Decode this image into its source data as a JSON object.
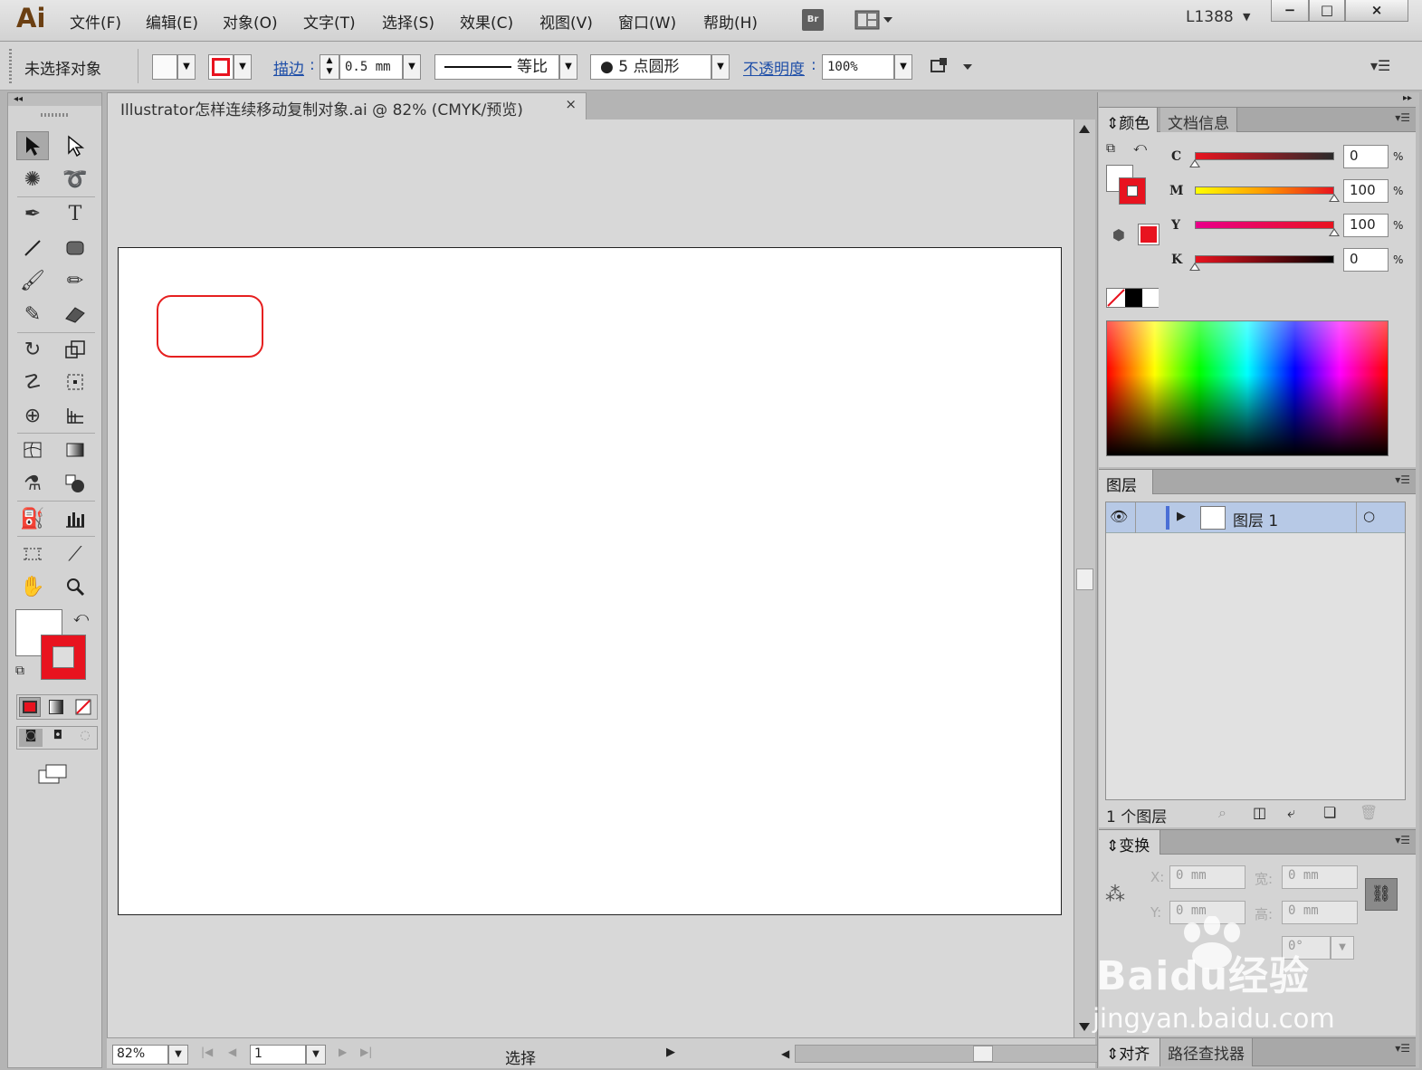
{
  "app": {
    "logo": "Ai",
    "workspace": "L1388"
  },
  "menu": [
    "文件(F)",
    "编辑(E)",
    "对象(O)",
    "文字(T)",
    "选择(S)",
    "效果(C)",
    "视图(V)",
    "窗口(W)",
    "帮助(H)"
  ],
  "bridge_button": "Br",
  "window_controls": {
    "minimize": "−",
    "maximize": "□",
    "close": "×"
  },
  "control_bar": {
    "selection_status": "未选择对象",
    "stroke_label": "描边",
    "stroke_weight": "0.5 mm",
    "stroke_profile": "等比",
    "brush": "5 点圆形",
    "opacity_label": "不透明度",
    "opacity_value": "100%"
  },
  "document": {
    "tab_title": "Illustrator怎样连续移动复制对象.ai @ 82% (CMYK/预览)",
    "close": "×"
  },
  "status_bar": {
    "zoom": "82%",
    "artboard_number": "1",
    "tool_status": "选择"
  },
  "color_panel": {
    "tabs": [
      "颜色",
      "文档信息"
    ],
    "channels": [
      {
        "label": "C",
        "value": "0",
        "position": 0
      },
      {
        "label": "M",
        "value": "100",
        "position": 1
      },
      {
        "label": "Y",
        "value": "100",
        "position": 1
      },
      {
        "label": "K",
        "value": "0",
        "position": 0
      }
    ],
    "percent": "%",
    "stroke_color": "#e8131f",
    "fill_color": "#ffffff"
  },
  "layers_panel": {
    "tab": "图层",
    "layer_name": "图层 1",
    "count_label": "1 个图层"
  },
  "transform_panel": {
    "tab": "变换",
    "x_label": "X:",
    "x_value": "0 mm",
    "y_label": "Y:",
    "y_value": "0 mm",
    "w_label": "宽:",
    "w_value": "0 mm",
    "h_label": "高:",
    "h_value": "0 mm",
    "shear_value": "0°"
  },
  "bottom_tabs": [
    "对齐",
    "路径查找器"
  ],
  "watermark": {
    "brand": "Baidu经验",
    "url": "jingyan.baidu.com"
  }
}
